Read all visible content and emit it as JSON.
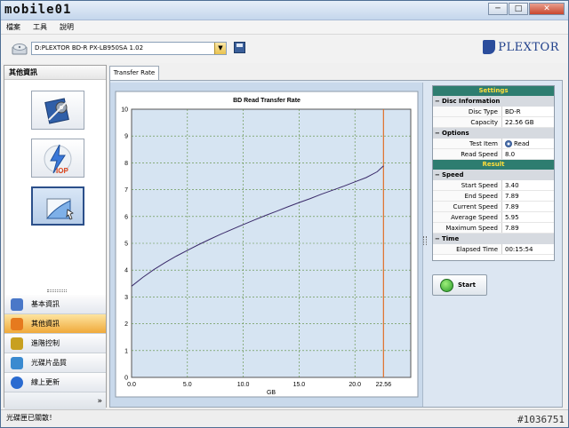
{
  "window": {
    "logo_text": "mobile01",
    "controls": {
      "minimize": "─",
      "maximize": "□",
      "close": "✕"
    }
  },
  "menu": [
    "檔案",
    "工具",
    "說明"
  ],
  "toolbar": {
    "drive_value": "D:PLEXTOR BD-R  PX-LB950SA 1.02",
    "dropdown_arrow": "▼",
    "brand": "PLEXTOR"
  },
  "sidebar": {
    "title": "其他資訊",
    "tiles": [
      {
        "name": "tool-tile-1",
        "icon": "config-icon"
      },
      {
        "name": "tool-tile-iop",
        "icon": "iop-lightning-icon",
        "label": "IOP"
      },
      {
        "name": "tool-tile-transfer",
        "icon": "transfer-chart-icon",
        "selected": true
      }
    ],
    "nav": [
      {
        "label": "基本資訊",
        "icon": "info-icon",
        "color": "#4a78c8"
      },
      {
        "label": "其他資訊",
        "icon": "other-info-icon",
        "color": "#e67a1e",
        "active": true
      },
      {
        "label": "進階控制",
        "icon": "advanced-control-icon",
        "color": "#c8a020"
      },
      {
        "label": "光碟片品質",
        "icon": "disc-quality-icon",
        "color": "#3a8ad0"
      },
      {
        "label": "線上更新",
        "icon": "online-update-icon",
        "color": "#2a6bd0"
      }
    ],
    "collapse_glyph": "»"
  },
  "tab": {
    "label": "Transfer Rate"
  },
  "chart_data": {
    "type": "line",
    "title": "BD Read Transfer Rate",
    "xlabel": "GB",
    "ylabel": "",
    "xlim": [
      0,
      25
    ],
    "ylim": [
      0,
      10
    ],
    "x_ticks": [
      "0.0",
      "5.0",
      "10.0",
      "15.0",
      "20.0",
      "22.56"
    ],
    "x_tick_values": [
      0,
      5,
      10,
      15,
      20,
      22.56
    ],
    "y_ticks": [
      "0",
      "1",
      "2",
      "3",
      "4",
      "5",
      "6",
      "7",
      "8",
      "9",
      "10"
    ],
    "marker_x": 22.56,
    "marker_color": "#e0702a",
    "grid": true,
    "series": [
      {
        "color": "#3a2a6a",
        "x": [
          0,
          1,
          2,
          3,
          4,
          5,
          6,
          7,
          8,
          9,
          10,
          11,
          12,
          13,
          14,
          15,
          16,
          17,
          18,
          19,
          20,
          21,
          22,
          22.56
        ],
        "y": [
          3.4,
          3.73,
          4.02,
          4.28,
          4.52,
          4.74,
          4.95,
          5.15,
          5.34,
          5.52,
          5.7,
          5.87,
          6.04,
          6.2,
          6.36,
          6.52,
          6.67,
          6.83,
          6.98,
          7.13,
          7.29,
          7.45,
          7.67,
          7.89
        ]
      }
    ]
  },
  "settings": {
    "header": "Settings",
    "disc_info_label": "Disc Information",
    "disc_type_key": "Disc Type",
    "disc_type_val": "BD-R",
    "capacity_key": "Capacity",
    "capacity_val": "22.56 GB",
    "options_label": "Options",
    "test_item_key": "Test Item",
    "test_item_val": "Read",
    "read_speed_key": "Read Speed",
    "read_speed_val": "8.0"
  },
  "result": {
    "header": "Result",
    "speed_label": "Speed",
    "start_speed_key": "Start Speed",
    "start_speed_val": "3.40",
    "end_speed_key": "End Speed",
    "end_speed_val": "7.89",
    "current_speed_key": "Current Speed",
    "current_speed_val": "7.89",
    "average_speed_key": "Average Speed",
    "average_speed_val": "5.95",
    "max_speed_key": "Maximum Speed",
    "max_speed_val": "7.89",
    "time_label": "Time",
    "elapsed_key": "Elapsed Time",
    "elapsed_val": "00:15:54"
  },
  "start_button": {
    "label": "Start"
  },
  "status": {
    "text": "光碟匣已關散！",
    "watermark": "#1036751"
  },
  "colors": {
    "settings_header_bg": "#2e7d70",
    "settings_header_fg": "#ffde3a",
    "active_nav": "#f0a93a"
  }
}
